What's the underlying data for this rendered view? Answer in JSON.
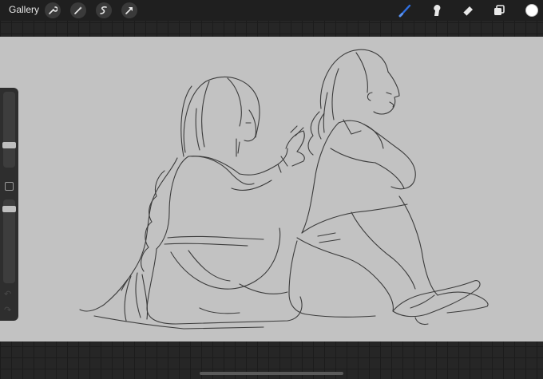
{
  "topbar": {
    "gallery_label": "Gallery",
    "left_tools": [
      "wrench-icon",
      "magic-wand-icon",
      "selection-icon",
      "transform-arrow-icon"
    ],
    "right_tools": [
      "brush-icon",
      "smudge-icon",
      "eraser-icon",
      "layers-icon"
    ],
    "active_tool": "brush-icon",
    "accent_color": "#2f6fe0",
    "current_color": "#ffffff"
  },
  "sidebar": {
    "brush_size_level": 0.33,
    "opacity_level": 0.95,
    "controls": [
      "brush-size-slider",
      "modify-button",
      "opacity-slider",
      "undo-icon",
      "redo-icon"
    ]
  },
  "canvas": {
    "background_color": "#c2c2c2",
    "stroke_color": "#3c3c3c"
  }
}
